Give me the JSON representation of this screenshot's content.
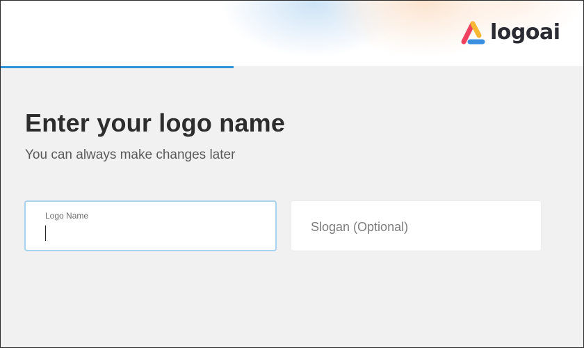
{
  "header": {
    "brand_name": "logoai",
    "logo_icon": "logoai-mark-icon",
    "colors": {
      "mark_red": "#f0425f",
      "mark_yellow": "#f7b733",
      "mark_blue": "#3b8fe0"
    }
  },
  "progress": {
    "fraction": 0.4,
    "color": "#2f95d8"
  },
  "main": {
    "title": "Enter your logo name",
    "subtitle": "You can always make changes later"
  },
  "form": {
    "logo_name": {
      "label": "Logo Name",
      "value": ""
    },
    "slogan": {
      "placeholder": "Slogan (Optional)",
      "value": ""
    }
  }
}
